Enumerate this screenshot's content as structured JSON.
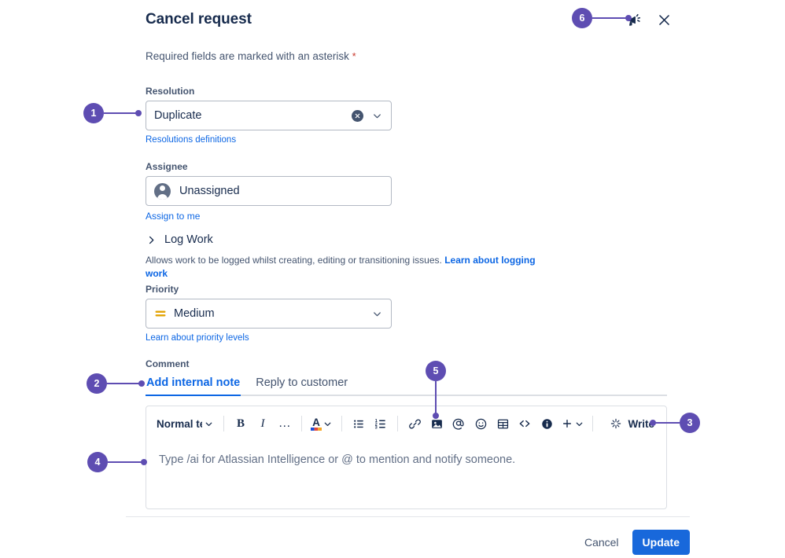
{
  "dialog": {
    "title": "Cancel request",
    "required_note": "Required fields are marked with an asterisk",
    "required_asterisk": "*",
    "header_actions": [
      {
        "name": "feedback-megaphone-icon",
        "label": "Give feedback"
      },
      {
        "name": "close-icon",
        "label": "Close"
      }
    ]
  },
  "fields": {
    "resolution": {
      "label": "Resolution",
      "value": "Duplicate",
      "clear_label": "Clear",
      "help_link": "Resolutions definitions"
    },
    "assignee": {
      "label": "Assignee",
      "value": "Unassigned",
      "avatar": "person-avatar-icon",
      "help_link": "Assign to me"
    },
    "log_work": {
      "label": "Log Work",
      "expanded": false,
      "description": "Allows work to be logged whilst creating, editing or transitioning issues.",
      "link": "Learn about logging work"
    },
    "priority": {
      "label": "Priority",
      "value": "Medium",
      "icon": "priority-medium-icon",
      "icon_color": "#e2a200",
      "help_link": "Learn about priority levels"
    },
    "comment": {
      "label": "Comment",
      "tabs": [
        {
          "label": "Add internal note",
          "active": true
        },
        {
          "label": "Reply to customer",
          "active": false
        }
      ]
    }
  },
  "editor": {
    "style_select": {
      "value": "Normal text",
      "icon": "chevron-down-icon"
    },
    "tools": [
      {
        "name": "bold-button",
        "label": "B"
      },
      {
        "name": "italic-button",
        "label": "I"
      },
      {
        "name": "more-formatting-button",
        "label": "…"
      },
      {
        "name": "text-color-button",
        "label": "A"
      },
      {
        "name": "bullet-list-button",
        "label": ""
      },
      {
        "name": "numbered-list-button",
        "label": ""
      },
      {
        "name": "link-button",
        "label": ""
      },
      {
        "name": "image-button",
        "label": ""
      },
      {
        "name": "mention-button",
        "label": "@"
      },
      {
        "name": "emoji-button",
        "label": ""
      },
      {
        "name": "table-button",
        "label": ""
      },
      {
        "name": "code-button",
        "label": "<>"
      },
      {
        "name": "info-panel-button",
        "label": ""
      },
      {
        "name": "insert-more-button",
        "label": "+"
      }
    ],
    "write_button": {
      "label": "Write",
      "icon": "ai-sparkle-icon"
    },
    "placeholder": "Type /ai for Atlassian Intelligence or @ to mention and notify someone."
  },
  "footer": {
    "cancel_label": "Cancel",
    "update_label": "Update"
  },
  "annotations": {
    "accent_color": "#5e4db2",
    "items": [
      {
        "number": "1",
        "target": "resolution-select"
      },
      {
        "number": "2",
        "target": "add-internal-note-tab"
      },
      {
        "number": "3",
        "target": "write-button"
      },
      {
        "number": "4",
        "target": "comment-editor-body"
      },
      {
        "number": "5",
        "target": "image-button"
      },
      {
        "number": "6",
        "target": "feedback-megaphone-icon"
      }
    ]
  },
  "colors": {
    "brand_blue": "#0c66e4",
    "primary_button": "#1868db",
    "annotation_purple": "#5e4db2",
    "required_red": "#c9372c",
    "priority_orange": "#e2a200"
  }
}
